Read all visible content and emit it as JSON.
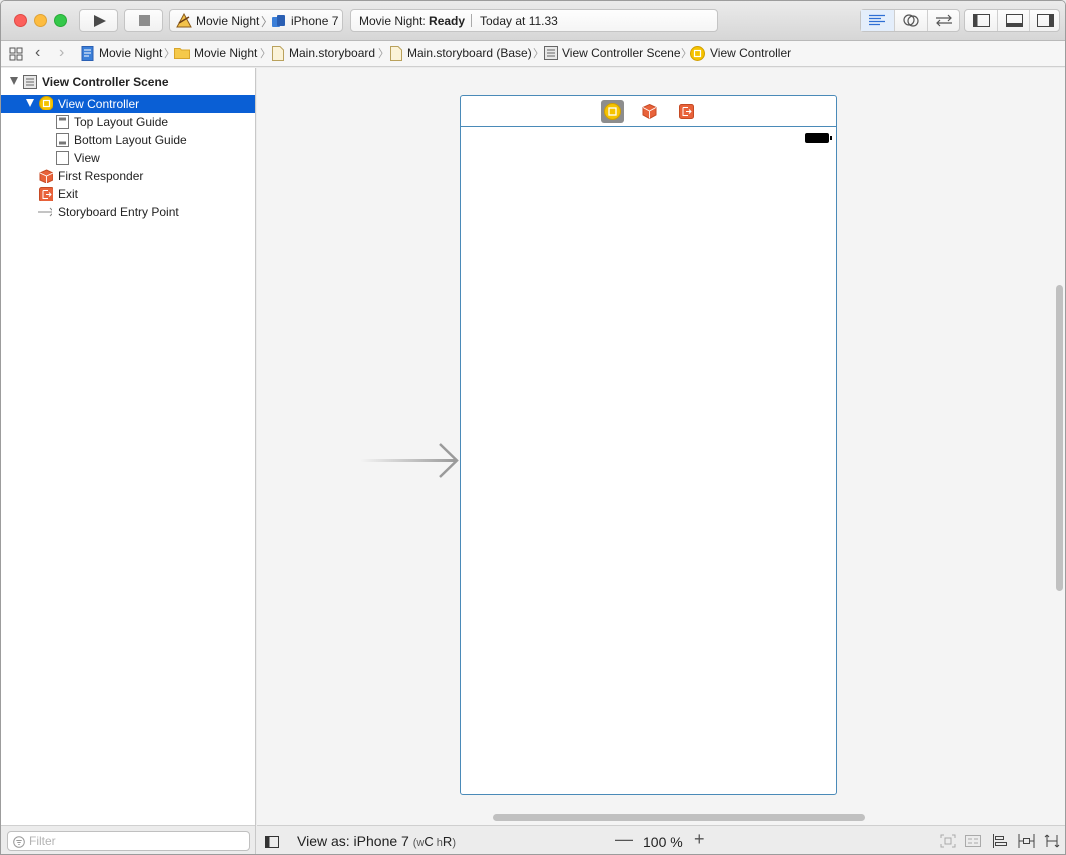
{
  "toolbar": {
    "scheme": "Movie Night",
    "device": "iPhone 7",
    "status_project": "Movie Night:",
    "status_state": "Ready",
    "status_time": "Today at 11.33"
  },
  "jumpbar": {
    "crumbs": [
      "Movie Night",
      "Movie Night",
      "Main.storyboard",
      "Main.storyboard (Base)",
      "View Controller Scene",
      "View Controller"
    ]
  },
  "navigator": {
    "items": [
      {
        "label": "View Controller Scene",
        "icon": "scene-icon"
      },
      {
        "label": "View Controller",
        "icon": "view-controller-icon"
      },
      {
        "label": "Top Layout Guide",
        "icon": "layout-guide-icon"
      },
      {
        "label": "Bottom Layout Guide",
        "icon": "layout-guide-icon"
      },
      {
        "label": "View",
        "icon": "view-icon"
      },
      {
        "label": "First Responder",
        "icon": "first-responder-icon"
      },
      {
        "label": "Exit",
        "icon": "exit-icon"
      },
      {
        "label": "Storyboard Entry Point",
        "icon": "entry-arrow-icon"
      }
    ],
    "filter_placeholder": "Filter"
  },
  "bottom": {
    "view_as_label": "View as: iPhone 7",
    "size_w": "w",
    "size_c": "C",
    "size_h": "h",
    "size_r": "R",
    "zoom_out": "—",
    "zoom_level": "100 %",
    "zoom_in": "+"
  },
  "colors": {
    "selection": "#0a5fd5",
    "frame_border": "#4a8ab8",
    "vc_yellow": "#f5c300",
    "responder_orange": "#e8623a"
  }
}
